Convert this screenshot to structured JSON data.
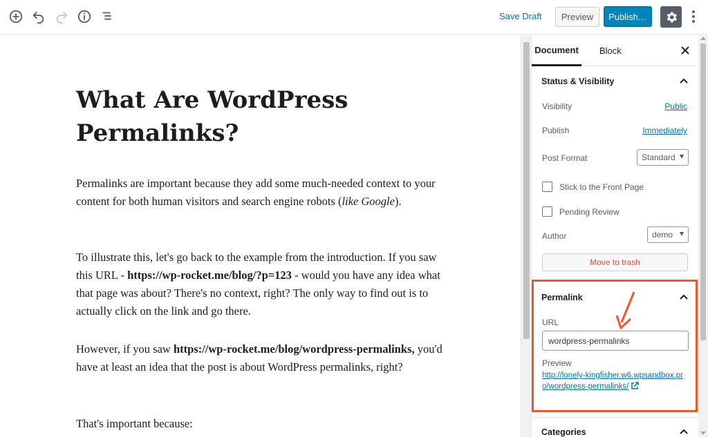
{
  "toolbar": {
    "icons": [
      "add-block-icon",
      "undo-icon",
      "redo-icon",
      "info-icon",
      "block-navigation-icon"
    ],
    "save_draft": "Save Draft",
    "preview": "Preview",
    "publish": "Publish…",
    "settings_icon": "gear-icon",
    "more_icon": "more-vertical-icon",
    "accent": "#0085ba"
  },
  "post": {
    "title": "What Are WordPress Permalinks?",
    "p1": {
      "text_a": "Permalinks are important because they add some much-needed context to your content for both human visitors and search engine robots (",
      "italic": "like Google",
      "text_b": ")."
    },
    "p2": {
      "text_a": "To illustrate this, let's go back to the example from the introduction. If you saw this URL - ",
      "bold": "https://wp-rocket.me/blog/?p=123",
      "text_b": " - would you have any idea what that page was about? There's no context, right? The only way to find out is to actually click on the link and go there."
    },
    "p3": {
      "text_a": "However, if you saw ",
      "bold": "https://wp-rocket.me/blog/wordpress-permalinks,",
      "text_b": " you'd have at least an idea that the post is about WordPress permalinks, right?"
    },
    "p4": "That's important because:"
  },
  "sidebar": {
    "tabs": [
      "Document",
      "Block"
    ],
    "status": {
      "title": "Status & Visibility",
      "visibility_label": "Visibility",
      "visibility_value": "Public",
      "publish_label": "Publish",
      "publish_value": "Immediately",
      "format_label": "Post Format",
      "format_value": "Standard",
      "sticky_label": "Stick to the Front Page",
      "pending_label": "Pending Review",
      "author_label": "Author",
      "author_value": "demo",
      "trash": "Move to trash",
      "trash_color": "#d94f4f"
    },
    "permalink": {
      "title": "Permalink",
      "url_label": "URL",
      "url_value": "wordpress-permalinks",
      "preview_label": "Preview",
      "preview_url": "http://lonely-kingfisher.w6.wpsandbox.pro/wordpress-permalinks/",
      "highlight_color": "#f2552c"
    },
    "categories": {
      "title": "Categories"
    }
  }
}
